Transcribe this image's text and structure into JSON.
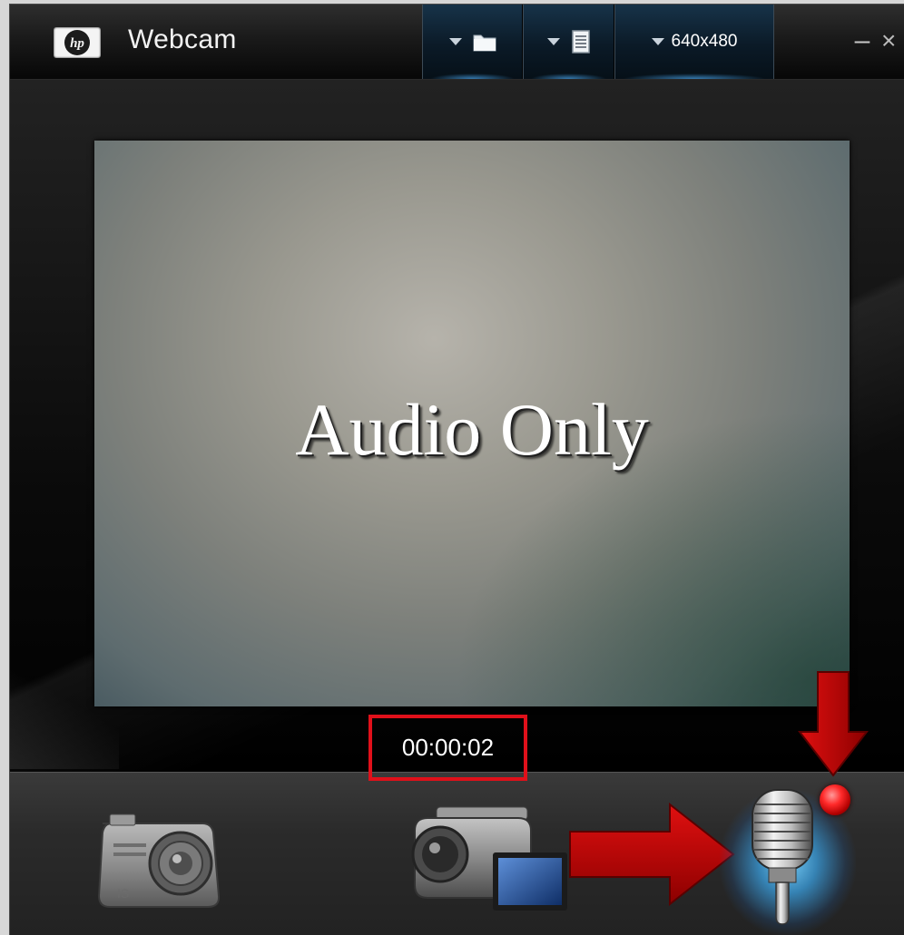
{
  "window": {
    "title": "Webcam",
    "minimize_label": "–",
    "close_label": "×"
  },
  "toolbar": {
    "folder_menu_icon": "folder-icon",
    "document_menu_icon": "document-icon",
    "resolution_label": "640x480"
  },
  "preview": {
    "overlay_text": "Audio Only"
  },
  "recording": {
    "elapsed_time": "00:00:02",
    "indicator_color": "#ff2a2a"
  },
  "modes": {
    "photo_icon": "camera-icon",
    "video_icon": "camcorder-icon",
    "audio_icon": "microphone-icon",
    "active": "audio"
  },
  "annotations": {
    "highlight_color": "#e0101a",
    "arrow_color": "#c80000"
  }
}
